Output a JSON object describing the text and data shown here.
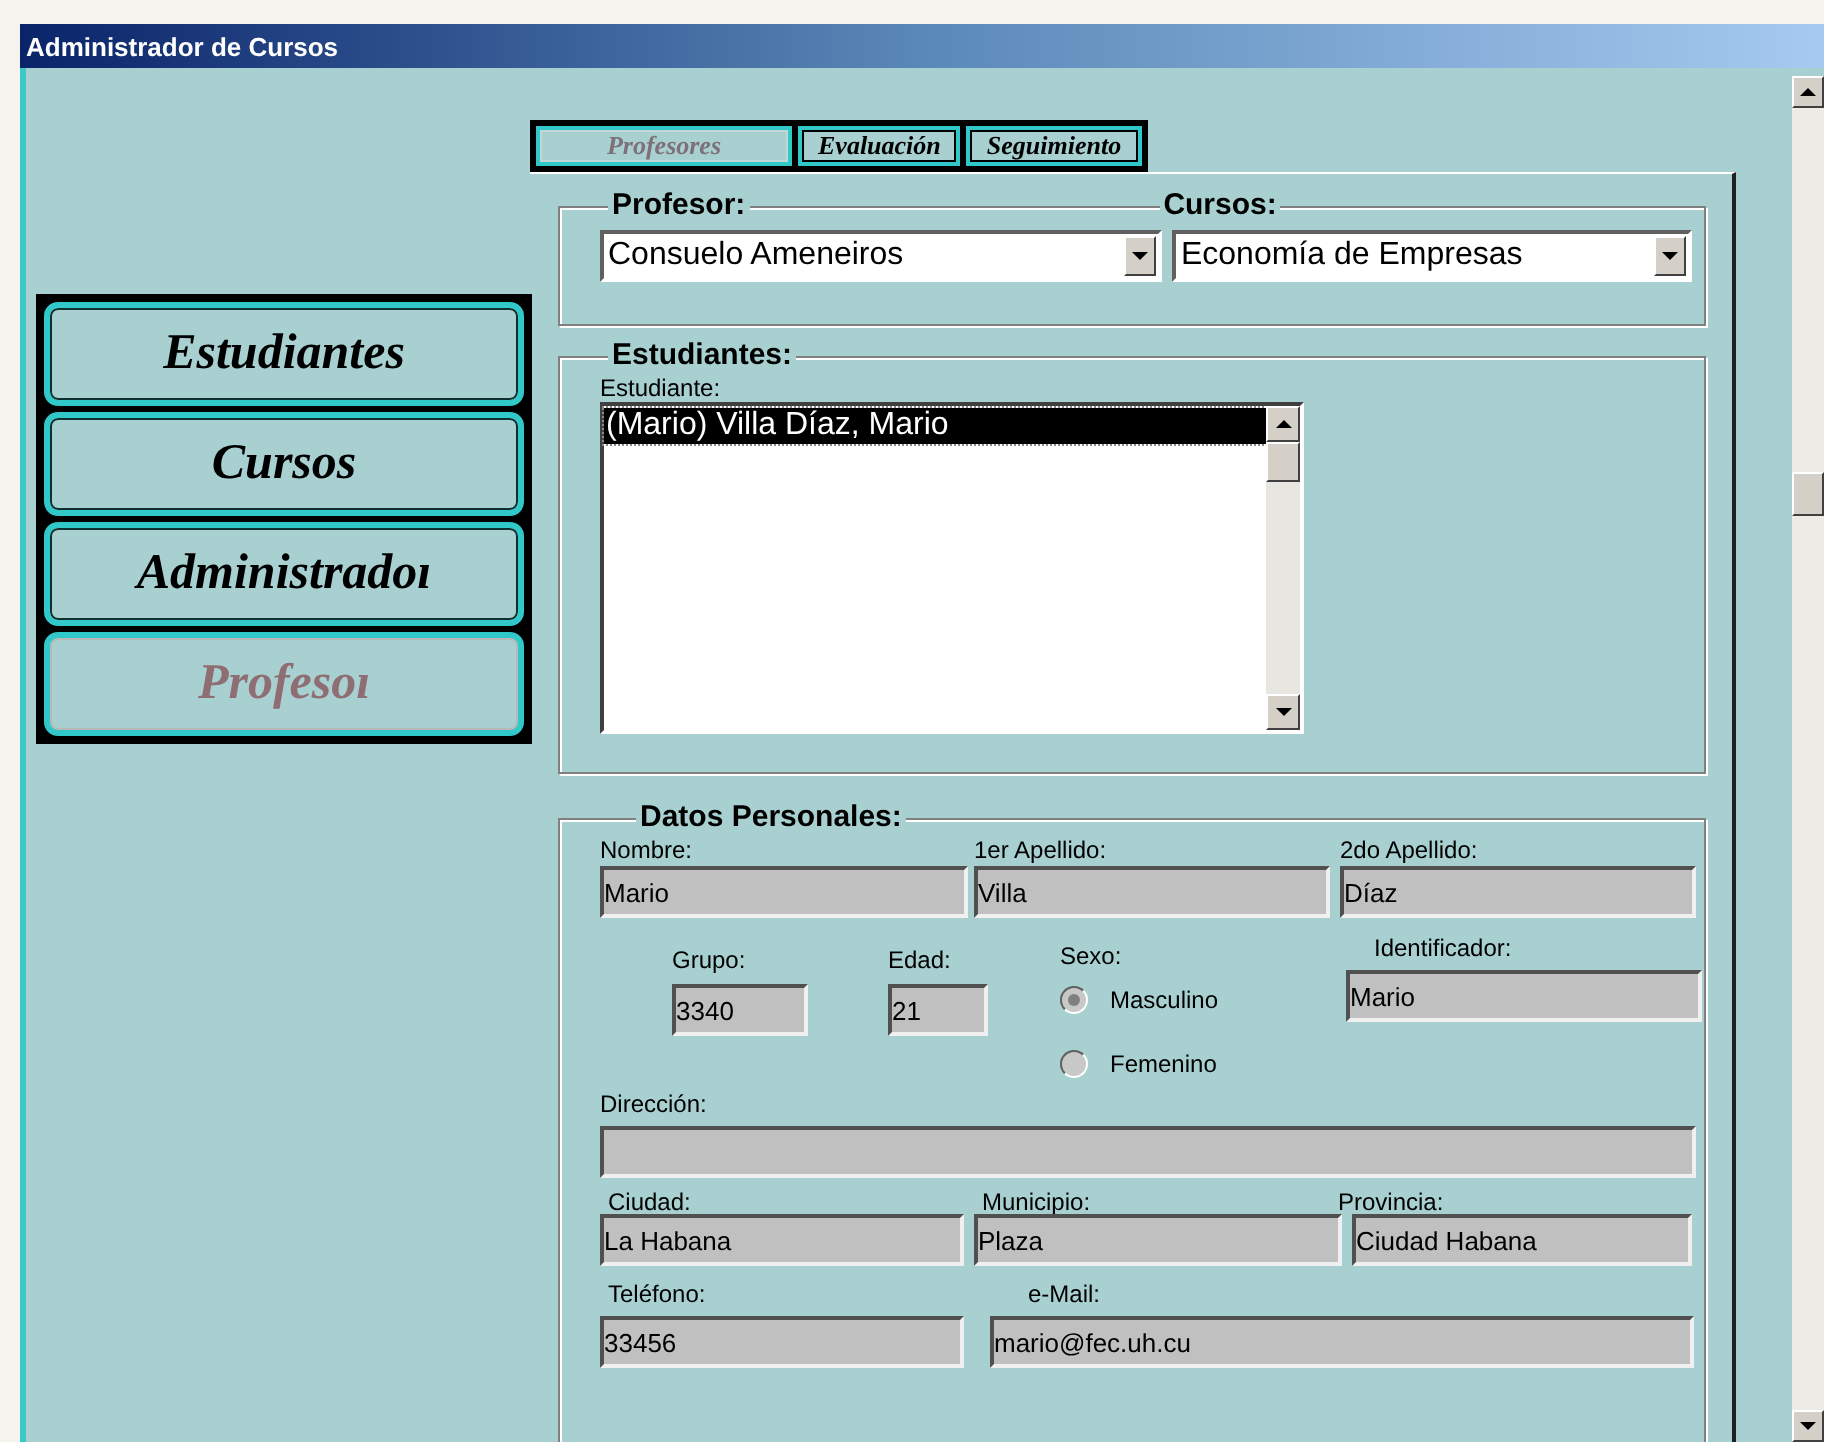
{
  "window": {
    "title": "Administrador de Cursos"
  },
  "nav": [
    {
      "label": "Estudiantes",
      "selected": false
    },
    {
      "label": "Cursos",
      "selected": false
    },
    {
      "label": "Administradoı",
      "selected": false
    },
    {
      "label": "Profesoı",
      "selected": true
    }
  ],
  "tabs": [
    {
      "label": "Profesores",
      "selected": true
    },
    {
      "label": "Evaluación",
      "selected": false
    },
    {
      "label": "Seguimiento",
      "selected": false
    }
  ],
  "profesor_group": {
    "title": "Profesor:",
    "value": "Consuelo Ameneiros"
  },
  "cursos_group": {
    "title": "Cursos:",
    "value": "Economía de Empresas"
  },
  "estudiantes_group": {
    "title": "Estudiantes:",
    "label": "Estudiante:",
    "items": [
      {
        "text": "(Mario) Villa Díaz, Mario",
        "selected": true
      }
    ]
  },
  "datos_personales": {
    "title": "Datos Personales:",
    "nombre": {
      "label": "Nombre:",
      "value": "Mario"
    },
    "apellido1": {
      "label": "1er Apellido:",
      "value": "Villa"
    },
    "apellido2": {
      "label": "2do Apellido:",
      "value": "Díaz"
    },
    "grupo": {
      "label": "Grupo:",
      "value": "3340"
    },
    "edad": {
      "label": "Edad:",
      "value": "21"
    },
    "sexo": {
      "label": "Sexo:",
      "options": [
        {
          "label": "Masculino",
          "selected": true
        },
        {
          "label": "Femenino",
          "selected": false
        }
      ]
    },
    "identificador": {
      "label": "Identificador:",
      "value": "Mario"
    },
    "direccion": {
      "label": "Dirección:"
    },
    "ciudad": {
      "label": "Ciudad:",
      "value": "La Habana"
    },
    "municipio": {
      "label": "Municipio:",
      "value": "Plaza"
    },
    "provincia": {
      "label": "Provincia:",
      "value": "Ciudad Habana"
    },
    "telefono": {
      "label": "Teléfono:",
      "value": "33456"
    },
    "email": {
      "label": "e-Mail:",
      "value": "mario@fec.uh.cu"
    }
  }
}
